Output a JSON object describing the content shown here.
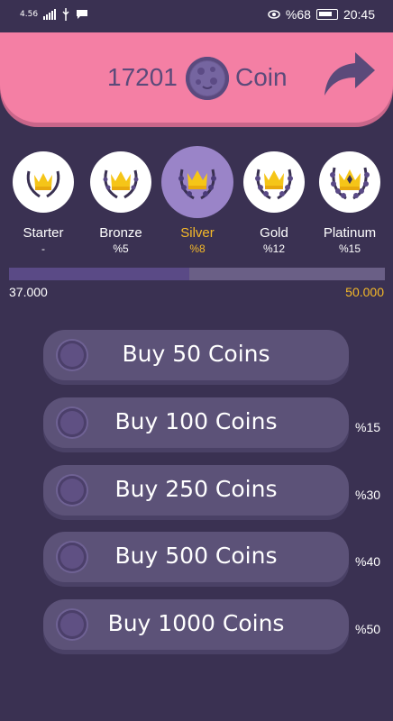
{
  "status_bar": {
    "network_small": "4.56",
    "battery_pct": "%68",
    "time": "20:45",
    "icons": [
      "signal-icon",
      "usb-icon",
      "message-icon",
      "eye-icon",
      "battery-icon"
    ]
  },
  "header": {
    "coin_count": "17201",
    "coin_label": "Coin",
    "colors": {
      "background": "#f47fa4",
      "text": "#5b4a7a"
    }
  },
  "tiers": [
    {
      "name": "Starter",
      "pct": "-"
    },
    {
      "name": "Bronze",
      "pct": "%5"
    },
    {
      "name": "Silver",
      "pct": "%8",
      "active": true
    },
    {
      "name": "Gold",
      "pct": "%12"
    },
    {
      "name": "Platinum",
      "pct": "%15"
    }
  ],
  "progress": {
    "min_label": "37.000",
    "max_label": "50.000",
    "fill_fraction": 0.48,
    "accent_color": "#f5b928"
  },
  "buy_buttons": [
    {
      "label": "Buy 50 Coins",
      "bonus": ""
    },
    {
      "label": "Buy 100 Coins",
      "bonus": "%15"
    },
    {
      "label": "Buy 250 Coins",
      "bonus": "%30"
    },
    {
      "label": "Buy 500 Coins",
      "bonus": "%40"
    },
    {
      "label": "Buy 1000 Coins",
      "bonus": "%50"
    }
  ]
}
